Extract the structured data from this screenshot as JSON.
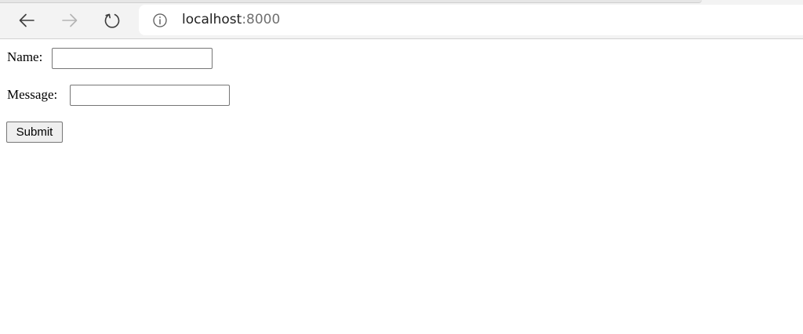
{
  "browser": {
    "url_host": "localhost",
    "url_port": ":8000",
    "icons": {
      "back": "arrow-left-icon",
      "forward": "arrow-right-icon",
      "reload": "refresh-icon",
      "site_info": "info-circle-icon"
    },
    "colors": {
      "toolbar_bg": "#f3f3f3",
      "icon_active": "#3c3c3c",
      "icon_disabled": "#b4b4b4"
    }
  },
  "form": {
    "name_label": "Name:",
    "name_value": "",
    "message_label": "Message:",
    "message_value": "",
    "submit_label": "Submit"
  }
}
